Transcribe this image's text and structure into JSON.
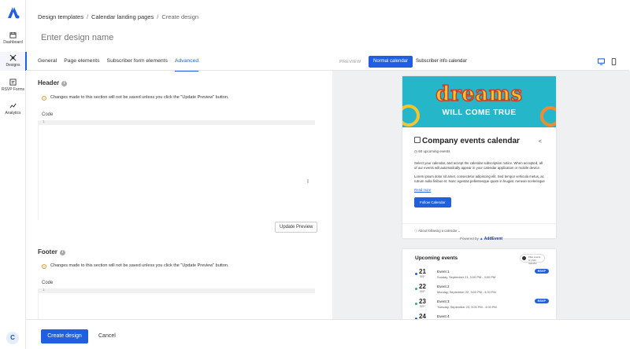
{
  "nav": {
    "items": [
      {
        "label": "Dashboard",
        "icon": "calendar-icon"
      },
      {
        "label": "Designs",
        "icon": "palette-icon"
      },
      {
        "label": "RSVP Forms",
        "icon": "form-icon"
      },
      {
        "label": "Analytics",
        "icon": "chart-icon"
      }
    ],
    "active": "Designs",
    "user_initial": "C",
    "accent": "#1f5fe0"
  },
  "breadcrumb": {
    "items": [
      "Design templates",
      "Calendar landing pages"
    ],
    "separator": "/",
    "current": "Create design"
  },
  "design_name": {
    "placeholder": "Enter design name",
    "value": ""
  },
  "tabs": [
    "General",
    "Page elements",
    "Subscriber form elements",
    "Advanced"
  ],
  "active_tab": "Advanced",
  "header_section": {
    "title": "Header",
    "notice": "Changes made to this section will not be saved unless you click the \"Update Preview\" button.",
    "code_label": "Code",
    "line_number": "1",
    "update_button": "Update Preview"
  },
  "footer_section": {
    "title": "Footer",
    "notice": "Changes made to this section will not be saved unless you click the \"Update Preview\" button.",
    "code_label": "Code",
    "line_number": "1"
  },
  "preview": {
    "label": "PREVIEW",
    "modes": [
      "Normal calendar",
      "Subscriber info calendar"
    ],
    "active_mode": "Normal calendar",
    "devices": [
      "desktop-icon",
      "mobile-icon"
    ],
    "banner": {
      "line1": "dreams",
      "line2": "WILL COME TRUE"
    },
    "calendar_title": "Company events calendar",
    "upcoming_count": "60 upcoming events",
    "description": "Select your calendar, and accept the calendar subscription notice. When accepted, all of our events will automatically appear in your calendar application or mobile device.",
    "lorem": "Lorem ipsum dolor sit amet, consectetur adipiscing elit. Sed tempor vehicula metus, ac rutrum nulla finibus et. Nunc egestas pellentesque quam in feugiat. Aenean scelerisque",
    "read_more": "Read more",
    "follow_button": "Follow Calendar",
    "about": "About following a calendar",
    "powered_by": "Powered by",
    "brand": "AddEvent",
    "events_title": "Upcoming events",
    "add_to_calendar": "Filter events to | Add calendar",
    "events": [
      {
        "day": "21",
        "month": "SEP",
        "name": "Event 1",
        "when": "Sunday, September 21, 3:00 PM - 4:00 PM",
        "rsvp": "RSVP",
        "dot": "#1f5fe0"
      },
      {
        "day": "22",
        "month": "SEP",
        "name": "Event 2",
        "when": "Monday, September 22, 3:00 PM - 4:00 PM",
        "rsvp": "",
        "dot": "#2bb673"
      },
      {
        "day": "23",
        "month": "SEP",
        "name": "Event 3",
        "when": "Tuesday, September 23, 3:00 PM - 4:00 PM",
        "rsvp": "RSVP",
        "dot": "#2bb673"
      },
      {
        "day": "24",
        "month": "SEP",
        "name": "Event 4",
        "when": "",
        "rsvp": "",
        "dot": "#1f5fe0"
      }
    ]
  },
  "actions": {
    "create": "Create design",
    "cancel": "Cancel"
  }
}
